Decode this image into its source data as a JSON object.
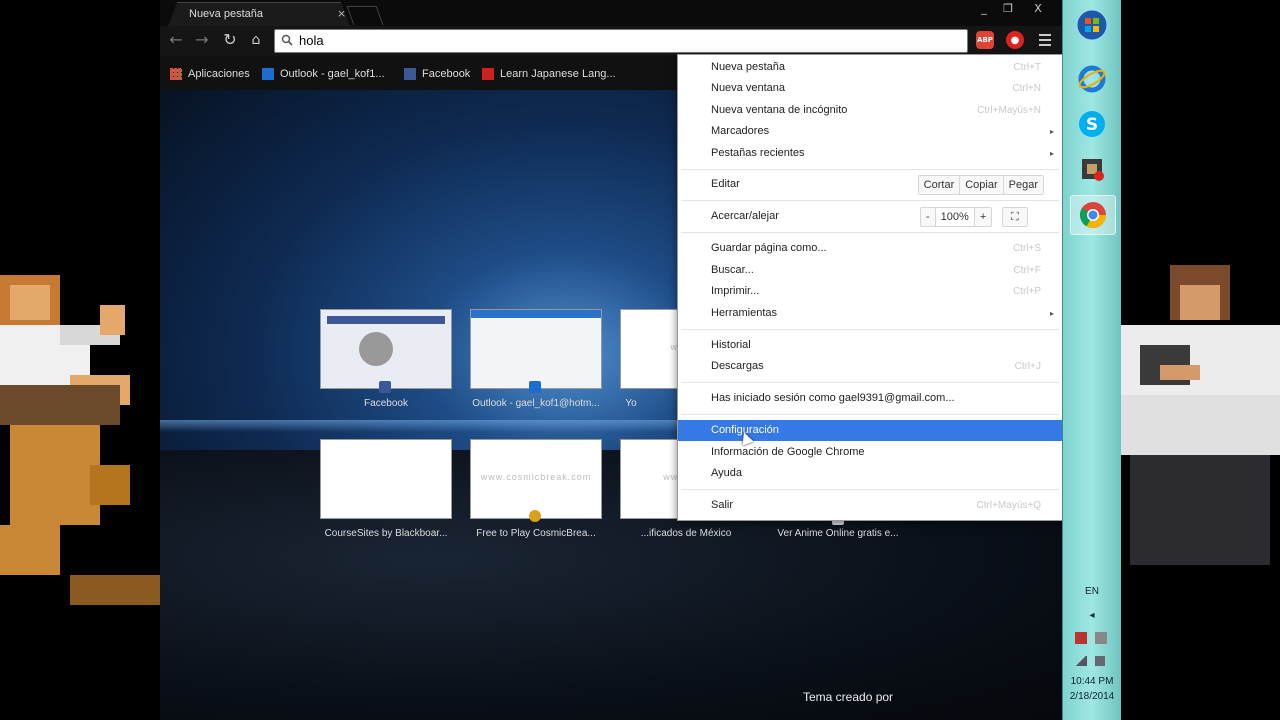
{
  "browser": {
    "tab_title": "Nueva pestaña",
    "tab_close": "×",
    "window_controls": {
      "minimize": "_",
      "restore": "❐",
      "close": "X"
    },
    "omnibox_value": "hola",
    "extensions": [
      {
        "name": "adblock-plus-icon",
        "text": "ABP",
        "color": "#d43"
      },
      {
        "name": "record-icon",
        "text": "●",
        "color": "#d22"
      }
    ],
    "bookmarks": [
      {
        "label": "Aplicaciones",
        "icon": "apps-grid-icon"
      },
      {
        "label": "Outlook - gael_kof1...",
        "icon": "outlook-icon"
      },
      {
        "label": "Facebook",
        "icon": "facebook-icon"
      },
      {
        "label": "Learn Japanese Lang...",
        "icon": "learn-japanese-icon"
      }
    ],
    "new_tab_page": {
      "tiles_row1": [
        {
          "label": "Facebook",
          "site_text": ""
        },
        {
          "label": "Outlook - gael_kof1@hotm...",
          "site_text": ""
        },
        {
          "label": "Yo",
          "site_text": "www.y"
        }
      ],
      "tiles_row2": [
        {
          "label": "CourseSites by Blackboar...",
          "site_text": ""
        },
        {
          "label": "Free to Play CosmicBrea...",
          "site_text": "www.cosmicbreak.com"
        },
        {
          "label": "...ificados de México",
          "site_text": "www.com"
        },
        {
          "label": "Ver Anime Online gratis e...",
          "site_text": ""
        }
      ],
      "theme_credit": "Tema creado por"
    }
  },
  "menu": {
    "group1": [
      {
        "label": "Nueva pestaña",
        "shortcut": "Ctrl+T"
      },
      {
        "label": "Nueva ventana",
        "shortcut": "Ctrl+N"
      },
      {
        "label": "Nueva ventana de incógnito",
        "shortcut": "Ctrl+Mayús+N"
      },
      {
        "label": "Marcadores",
        "shortcut": "▸"
      },
      {
        "label": "Pestañas recientes",
        "shortcut": "▸"
      }
    ],
    "edit": {
      "label": "Editar",
      "cut": "Cortar",
      "copy": "Copiar",
      "paste": "Pegar"
    },
    "zoom": {
      "label": "Acercar/alejar",
      "minus": "-",
      "value": "100%",
      "plus": "+",
      "fullscreen": "⛶"
    },
    "group3": [
      {
        "label": "Guardar página como...",
        "shortcut": "Ctrl+S"
      },
      {
        "label": "Buscar...",
        "shortcut": "Ctrl+F"
      },
      {
        "label": "Imprimir...",
        "shortcut": "Ctrl+P"
      },
      {
        "label": "Herramientas",
        "shortcut": "▸"
      }
    ],
    "group4": [
      {
        "label": "Historial",
        "shortcut": ""
      },
      {
        "label": "Descargas",
        "shortcut": "Ctrl+J"
      }
    ],
    "signed_in": "Has iniciado sesión como gael9391@gmail.com...",
    "group5": [
      {
        "label": "Configuración",
        "shortcut": ""
      },
      {
        "label": "Información de Google Chrome",
        "shortcut": ""
      },
      {
        "label": "Ayuda",
        "shortcut": ""
      }
    ],
    "exit": {
      "label": "Salir",
      "shortcut": "Ctrl+Mayús+Q"
    }
  },
  "taskbar": {
    "apps": [
      "start-orb-icon",
      "internet-explorer-icon",
      "skype-icon",
      "game-icon",
      "chrome-icon"
    ],
    "language": "EN",
    "time": "10:44 PM",
    "date": "2/18/2014"
  }
}
